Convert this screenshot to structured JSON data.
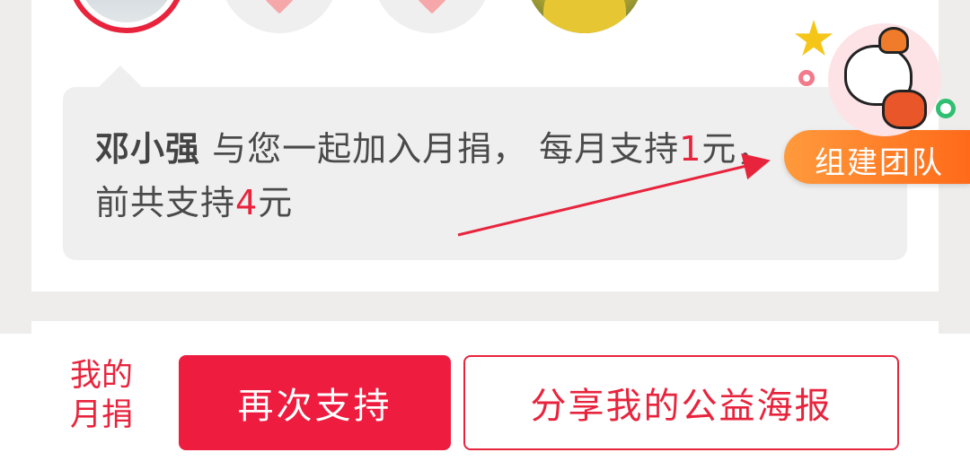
{
  "message": {
    "name": "邓小强",
    "line1_text": " 与您一起加入月捐， 每月支持",
    "monthly_amount": "1",
    "line1_unit": "元，",
    "line2_prefix": "前共支持",
    "total_amount": "4",
    "line2_unit": "元"
  },
  "floating": {
    "team_label": "组建团队"
  },
  "bottom": {
    "my_label_line1": "我的",
    "my_label_line2": "月捐",
    "support_again": "再次支持",
    "share_poster": "分享我的公益海报"
  },
  "colors": {
    "accent_red": "#e8243d",
    "button_red": "#ee1c3f",
    "orange": "#ff7a1a",
    "page_bg": "#eeedeb"
  },
  "icons": [
    "avatar-photo",
    "heart-icon",
    "star-icon",
    "mascot-icon",
    "arrow-annotation"
  ]
}
